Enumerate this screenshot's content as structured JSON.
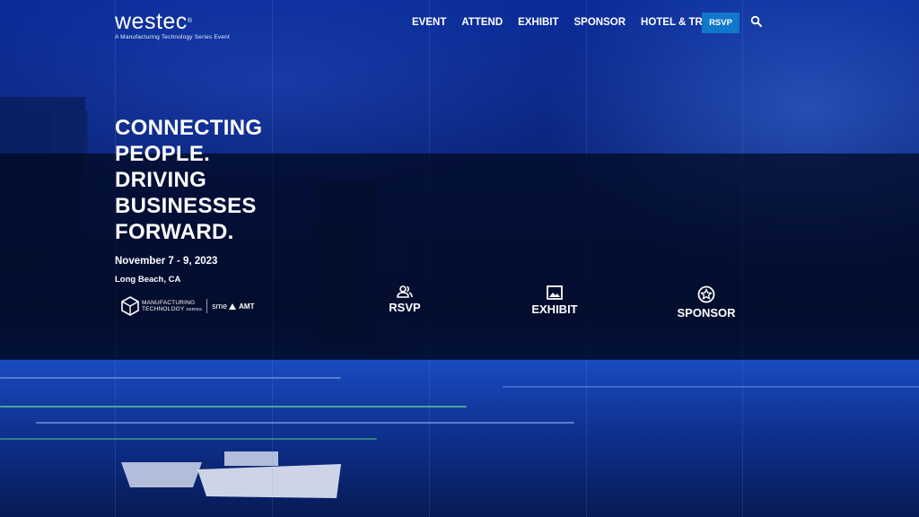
{
  "logo": {
    "wordmark": "westec",
    "registered": "®",
    "tagline": "A Manufacturing Technology Series Event"
  },
  "nav": {
    "items": [
      "EVENT",
      "ATTEND",
      "EXHIBIT",
      "SPONSOR",
      "HOTEL & TRAVEL"
    ],
    "rsvp_label": "RSVP"
  },
  "hero": {
    "headline": [
      "CONNECTING",
      "PEOPLE.",
      "DRIVING",
      "BUSINESSES",
      "FORWARD."
    ],
    "dates": "November 7 - 9, 2023",
    "location": "Long Beach, CA"
  },
  "brand": {
    "series_line1": "MANUFACTURING",
    "series_line2": "TECHNOLOGY",
    "series_line3": "SERIES",
    "partner1": "sme",
    "partner2": "AMT"
  },
  "cta": [
    {
      "label": "RSVP",
      "icon": "people-icon"
    },
    {
      "label": "EXHIBIT",
      "icon": "image-icon"
    },
    {
      "label": "SPONSOR",
      "icon": "star-badge-icon"
    }
  ],
  "colors": {
    "accent": "#1177c8",
    "band": "#020820",
    "background": "#0a2478"
  }
}
